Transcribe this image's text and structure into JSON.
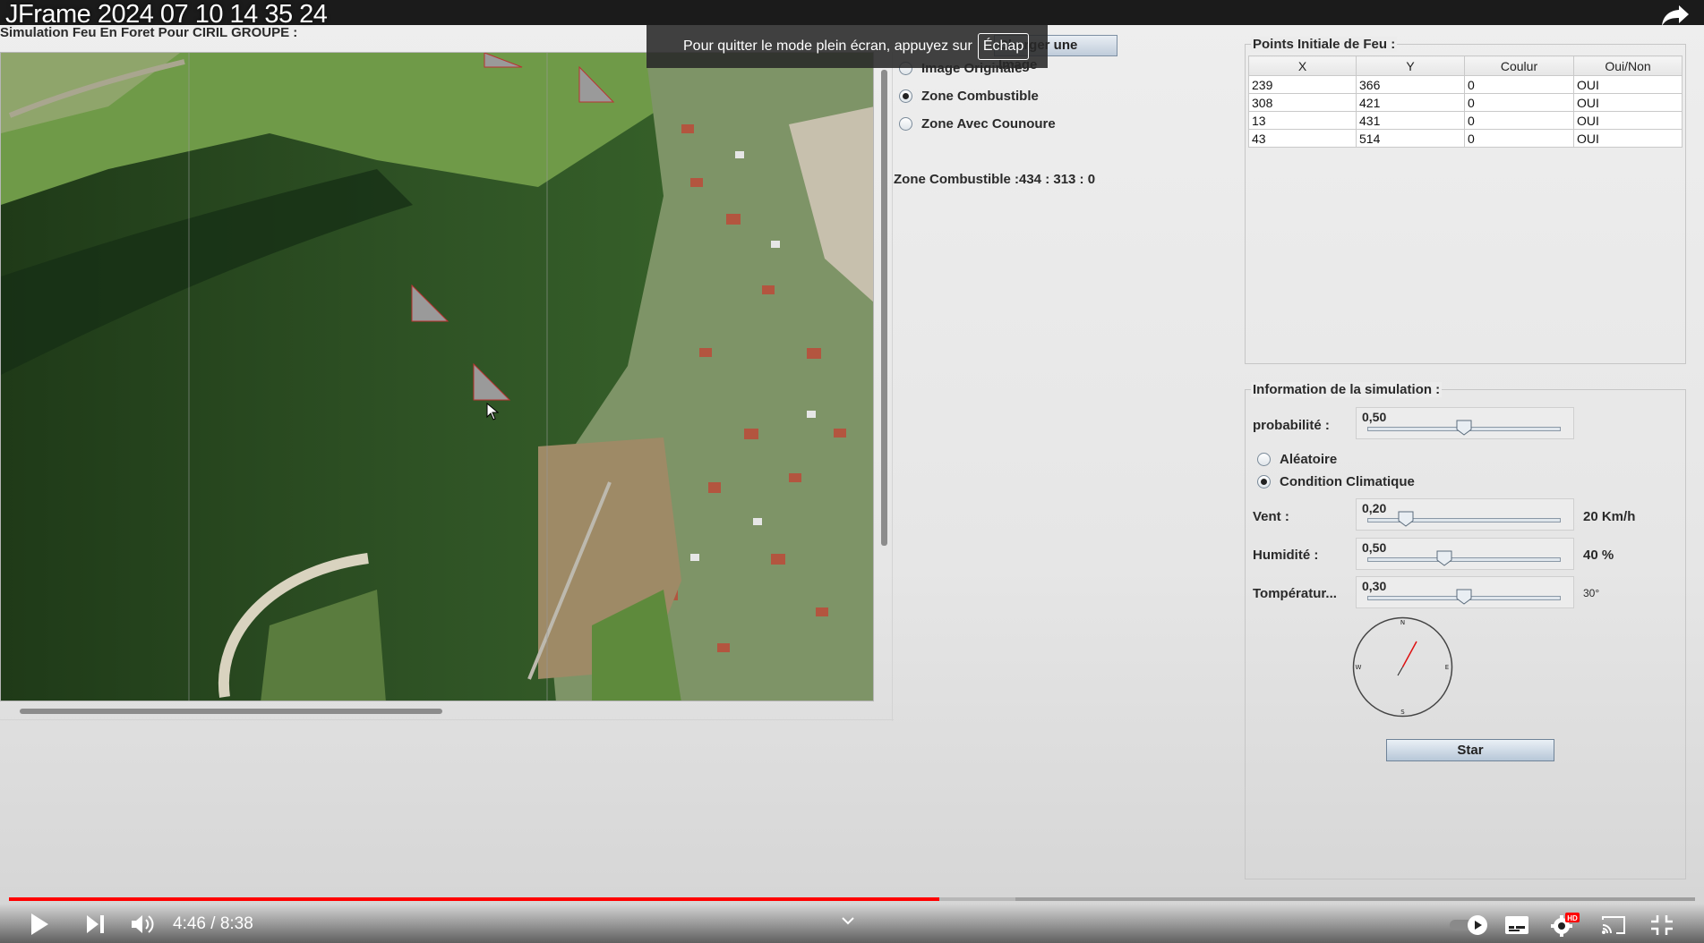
{
  "video": {
    "title": "JFrame 2024 07 10 14 35 24",
    "current_time": "4:46",
    "separator": " / ",
    "duration": "8:38",
    "progress_fraction": 0.552,
    "buffered_fraction": 0.597,
    "toast": {
      "text": "Pour quitter le mode plein écran, appuyez sur",
      "key": "Échap"
    },
    "quality_badge": "HD"
  },
  "app": {
    "title": "Simulation Feu En Foret Pour CIRIL GROUPE :",
    "load_button_label": "Charger une Image",
    "radio_options": [
      {
        "label": "Image Originale",
        "selected": false
      },
      {
        "label": "Zone Combustible",
        "selected": true
      },
      {
        "label": "Zone Avec Counoure",
        "selected": false
      }
    ],
    "zone_info": "Zone Combustible :434 : 313 : 0",
    "points_box": {
      "legend": "Points Initiale de Feu :",
      "columns": [
        "X",
        "Y",
        "Coulur",
        "Oui/Non"
      ],
      "rows": [
        [
          "239",
          "366",
          "0",
          "OUI"
        ],
        [
          "308",
          "421",
          "0",
          "OUI"
        ],
        [
          "13",
          "431",
          "0",
          "OUI"
        ],
        [
          "43",
          "514",
          "0",
          "OUI"
        ]
      ]
    },
    "sim_box": {
      "legend": "Information de la simulation :",
      "probabilite": {
        "label": "probabilité :",
        "value": "0,50",
        "fraction": 0.5
      },
      "mode_options": [
        {
          "label": "Aléatoire",
          "selected": false
        },
        {
          "label": "Condition Climatique",
          "selected": true
        }
      ],
      "vent": {
        "label": "Vent :",
        "value": "0,20",
        "fraction": 0.2,
        "unit": "20 Km/h"
      },
      "humidite": {
        "label": "Humidité :",
        "value": "0,50",
        "fraction": 0.4,
        "unit": "40 %"
      },
      "temperature": {
        "label": "Tompératur...",
        "value": "0,30",
        "fraction": 0.5,
        "unit": "30°"
      },
      "compass": {
        "n": "N",
        "s": "S",
        "e": "E",
        "w": "W"
      },
      "start_button_label": "Star"
    },
    "colors": {
      "accent_red": "#ff0000",
      "button_blue": "#b7c7d8"
    }
  }
}
